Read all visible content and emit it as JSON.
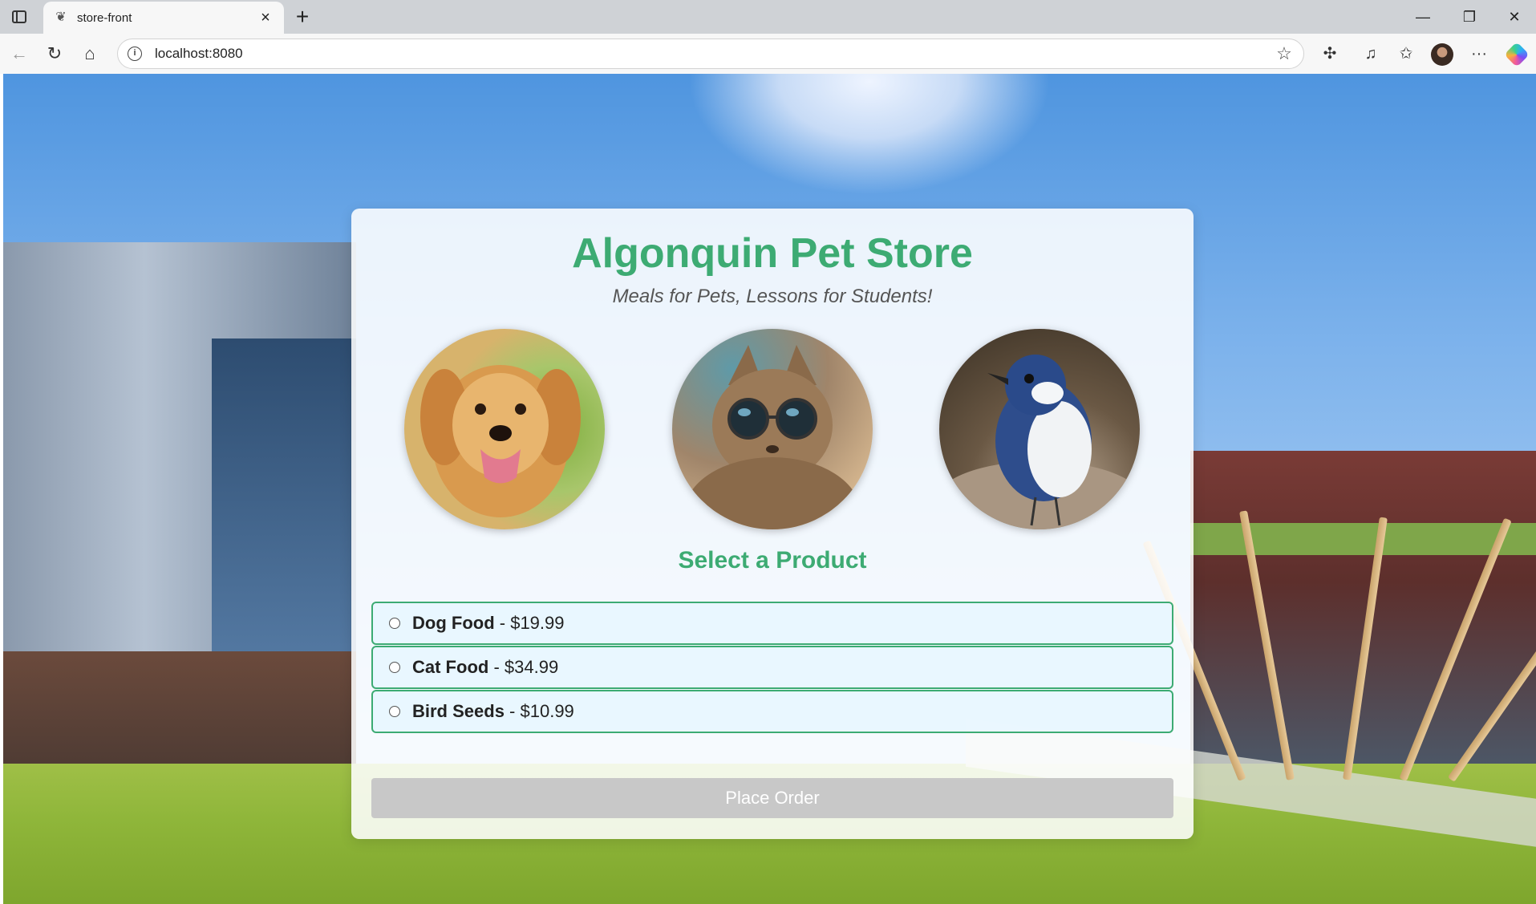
{
  "browser": {
    "tab_title": "store-front",
    "tab_icon": "bird-feather-icon",
    "new_tab": "+",
    "url": "localhost:8080",
    "window_controls": {
      "minimize": "—",
      "restore": "❐",
      "close": "✕"
    },
    "nav": {
      "back": "←",
      "reload": "↻",
      "home": "⌂"
    },
    "toolbar_icons": [
      "extensions-icon",
      "media-icon",
      "favorites-icon",
      "profile-avatar",
      "more-icon",
      "copilot-icon"
    ],
    "more": "···"
  },
  "store": {
    "title": "Algonquin Pet Store",
    "tagline": "Meals for Pets, Lessons for Students!",
    "pets": [
      "dog-photo",
      "cat-photo",
      "bird-photo"
    ],
    "section_title": "Select a Product",
    "products": [
      {
        "name": "Dog Food",
        "price": "$19.99"
      },
      {
        "name": "Cat Food",
        "price": "$34.99"
      },
      {
        "name": "Bird Seeds",
        "price": "$10.99"
      }
    ],
    "separator": " - ",
    "place_order": "Place Order"
  },
  "colors": {
    "accent": "#3dab73",
    "button_disabled": "#c8c8c8",
    "option_bg": "#e8f6ff"
  }
}
